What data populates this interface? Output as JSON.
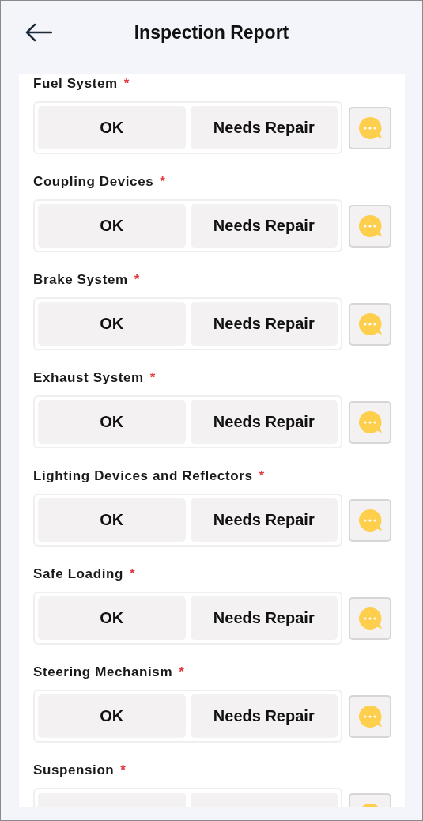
{
  "header": {
    "title": "Inspection Report"
  },
  "items": [
    {
      "label": "Fuel System",
      "mark": "*",
      "options": [
        {
          "label": "OK",
          "selected": false
        },
        {
          "label": "Needs Repair",
          "selected": false
        }
      ]
    },
    {
      "label": "Coupling Devices",
      "mark": "*",
      "options": [
        {
          "label": "OK",
          "selected": false
        },
        {
          "label": "Needs Repair",
          "selected": false
        }
      ]
    },
    {
      "label": "Brake System",
      "mark": "*",
      "options": [
        {
          "label": "OK",
          "selected": false
        },
        {
          "label": "Needs Repair",
          "selected": false
        }
      ]
    },
    {
      "label": "Exhaust System",
      "mark": "*",
      "options": [
        {
          "label": "OK",
          "selected": false
        },
        {
          "label": "Needs Repair",
          "selected": false
        }
      ]
    },
    {
      "label": "Lighting Devices and Reflectors",
      "mark": "*",
      "options": [
        {
          "label": "OK",
          "selected": false
        },
        {
          "label": "Needs Repair",
          "selected": false
        }
      ]
    },
    {
      "label": "Safe Loading",
      "mark": "*",
      "options": [
        {
          "label": "OK",
          "selected": false
        },
        {
          "label": "Needs Repair",
          "selected": false
        }
      ]
    },
    {
      "label": "Steering Mechanism",
      "mark": "*",
      "options": [
        {
          "label": "OK",
          "selected": false
        },
        {
          "label": "Needs Repair",
          "selected": false
        }
      ]
    },
    {
      "label": "Suspension",
      "mark": "*",
      "options": [
        {
          "selected": false
        },
        {
          "selected": false
        }
      ]
    }
  ]
}
